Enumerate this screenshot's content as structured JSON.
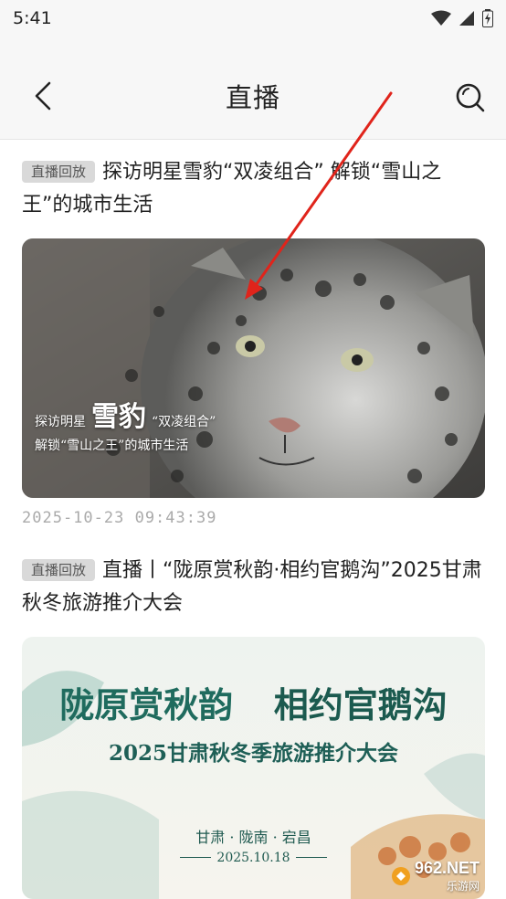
{
  "status": {
    "time": "5:41"
  },
  "nav": {
    "title": "直播"
  },
  "articles": [
    {
      "badge": "直播回放",
      "title": "探访明星雪豹“双凌组合” 解锁“雪山之王”的城市生活",
      "image_caption": {
        "line1_prefix": "探访明星",
        "line1_big": "雪豹",
        "line1_suffix": "“双凌组合”",
        "line2": "解锁“雪山之王”的城市生活"
      },
      "timestamp": "2025-10-23 09:43:39"
    },
    {
      "badge": "直播回放",
      "title": "直播丨“陇原赏秋韵·相约官鹅沟”2025甘肃秋冬旅游推介大会",
      "image_text": {
        "headline_left": "陇原赏秋韵",
        "headline_right": "相约官鹅沟",
        "subtitle": "2025甘肃秋冬季旅游推介大会",
        "places": "甘肃 · 陇南 · 宕昌",
        "date": "2025.10.18"
      }
    }
  ],
  "watermark": {
    "brand": "962.NET",
    "sub": "乐游网"
  }
}
